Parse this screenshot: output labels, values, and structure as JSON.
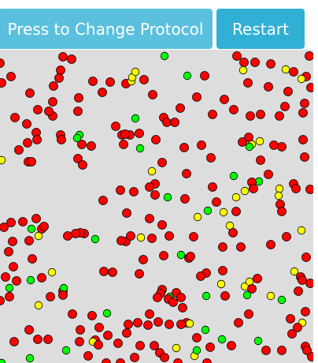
{
  "buttons": {
    "protocol_label": "Press to Change Protocol",
    "restart_label": "Restart"
  },
  "simulation": {
    "background": "#dddddd",
    "colors": {
      "infected": "#ff0000",
      "exposed": "#ffff00",
      "recovered": "#00ff00",
      "outline": "#000000"
    }
  }
}
